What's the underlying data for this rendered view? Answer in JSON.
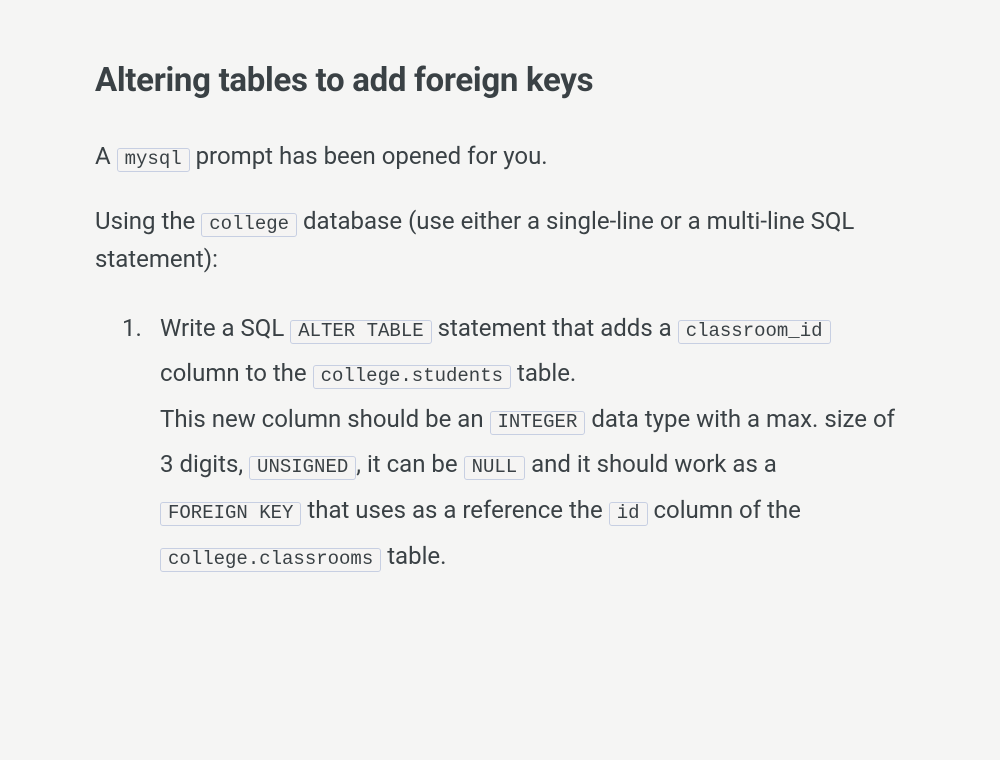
{
  "heading": "Altering tables to add foreign keys",
  "para1": {
    "t1": "A ",
    "code1": "mysql",
    "t2": " prompt has been opened for you."
  },
  "para2": {
    "t1": "Using the ",
    "code1": "college",
    "t2": " database (use either a single-line or a multi-line SQL statement):"
  },
  "item1": {
    "t1": "Write a SQL ",
    "code1": "ALTER TABLE",
    "t2": " statement that adds a ",
    "code2": "classroom_id",
    "t3": " column to the ",
    "code3": "college.students",
    "t4": " table.",
    "t5": "This new column should be an ",
    "code4": "INTEGER",
    "t6": " data type with a max. size of 3 digits, ",
    "code5": "UNSIGNED",
    "t7": ", it can be ",
    "code6": "NULL",
    "t8": " and it should work as a ",
    "code7": "FOREIGN KEY",
    "t9": " that uses as a reference the ",
    "code8": "id",
    "t10": " column of the ",
    "code9": "college.classrooms",
    "t11": " table."
  }
}
